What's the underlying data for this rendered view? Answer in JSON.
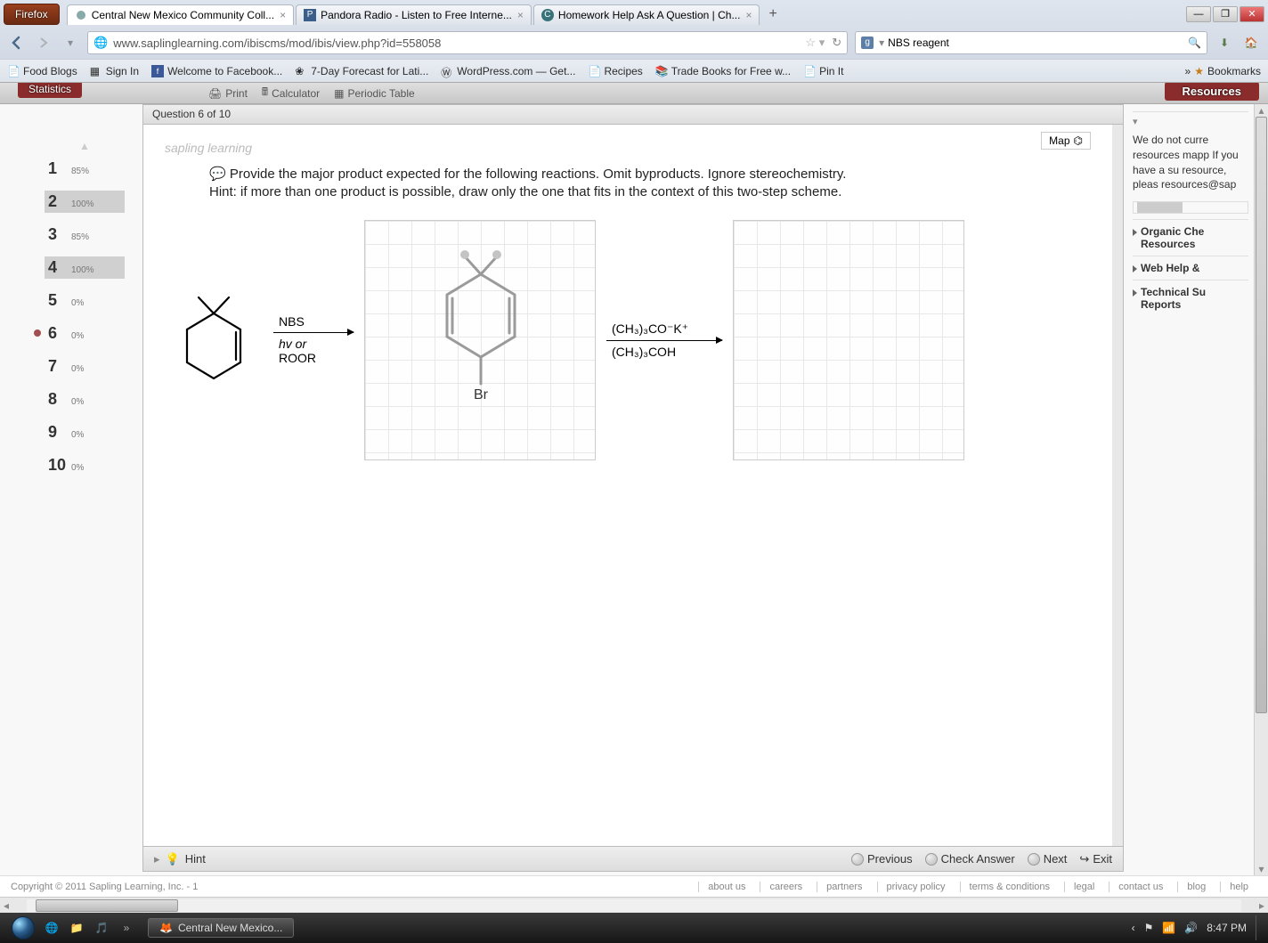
{
  "browser": {
    "name": "Firefox",
    "tabs": [
      {
        "title": "Central New Mexico Community Coll...",
        "active": true
      },
      {
        "title": "Pandora Radio - Listen to Free Interne...",
        "active": false,
        "favicon": "P"
      },
      {
        "title": "Homework Help Ask A Question | Ch...",
        "active": false,
        "favicon": "C"
      }
    ],
    "url": "www.saplinglearning.com/ibiscms/mod/ibis/view.php?id=558058",
    "search_value": "NBS reagent",
    "bookmarks": [
      "Food Blogs",
      "Sign In",
      "Welcome to Facebook...",
      "7-Day Forecast for Lati...",
      "WordPress.com — Get...",
      "Recipes",
      "Trade Books for Free w...",
      "Pin It"
    ],
    "bookmarks_more": "Bookmarks"
  },
  "app": {
    "statistics_label": "Statistics",
    "tools": {
      "print": "Print",
      "calculator": "Calculator",
      "periodic": "Periodic Table"
    },
    "resources_label": "Resources",
    "question_header": "Question 6 of 10",
    "logo_text": "sapling learning",
    "map_label": "Map",
    "question_text_line1": "Provide the major product expected for the following reactions. Omit byproducts. Ignore stereochemistry.",
    "question_text_line2": "Hint: if more than one product is possible, draw only the one that fits in the context of this two-step scheme.",
    "reagent1_line1": "NBS",
    "reagent1_line2": "hv or",
    "reagent1_line3": "ROOR",
    "reagent2_line1": "(CH₃)₃CO⁻K⁺",
    "reagent2_line2": "(CH₃)₃COH",
    "intermediate_label": "Br",
    "hint_label": "Hint",
    "prev_label": "Previous",
    "check_label": "Check Answer",
    "next_label": "Next",
    "exit_label": "Exit",
    "resources_text": "We do not curre resources mapp If you have a su resource, pleas resources@sap",
    "res_links": [
      "Organic Che Resources",
      "Web Help &",
      "Technical Su Reports"
    ]
  },
  "questions": [
    {
      "num": "1",
      "pct": "85%"
    },
    {
      "num": "2",
      "pct": "100%"
    },
    {
      "num": "3",
      "pct": "85%"
    },
    {
      "num": "4",
      "pct": "100%"
    },
    {
      "num": "5",
      "pct": "0%"
    },
    {
      "num": "6",
      "pct": "0%",
      "current": true
    },
    {
      "num": "7",
      "pct": "0%"
    },
    {
      "num": "8",
      "pct": "0%"
    },
    {
      "num": "9",
      "pct": "0%"
    },
    {
      "num": "10",
      "pct": "0%"
    }
  ],
  "footer": {
    "copyright": "Copyright © 2011 Sapling Learning, Inc. - 1",
    "links": [
      "about us",
      "careers",
      "partners",
      "privacy policy",
      "terms & conditions",
      "legal",
      "contact us",
      "blog",
      "help"
    ]
  },
  "taskbar": {
    "app": "Central New Mexico...",
    "time": "8:47 PM"
  }
}
